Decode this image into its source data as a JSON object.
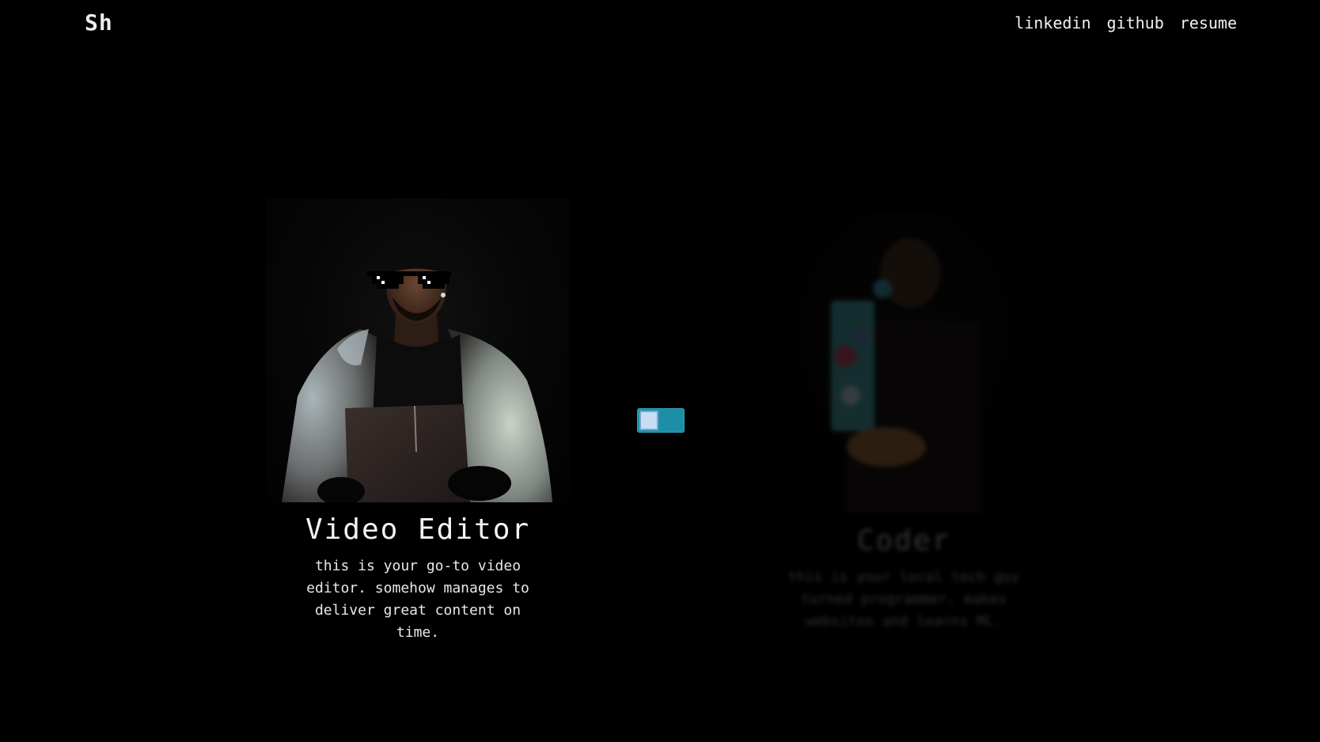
{
  "header": {
    "logo": "Sh",
    "nav": [
      {
        "label": "linkedin"
      },
      {
        "label": "github"
      },
      {
        "label": "resume"
      }
    ]
  },
  "cards": [
    {
      "title": "Video Editor",
      "description": "this is your go-to video editor. somehow manages to deliver great content on time."
    },
    {
      "title": "Coder",
      "description": "this is your local tech guy turned programmer, makes websites and learns ML."
    }
  ],
  "toggle": {
    "state": "left",
    "color": "#1c8fa6"
  }
}
